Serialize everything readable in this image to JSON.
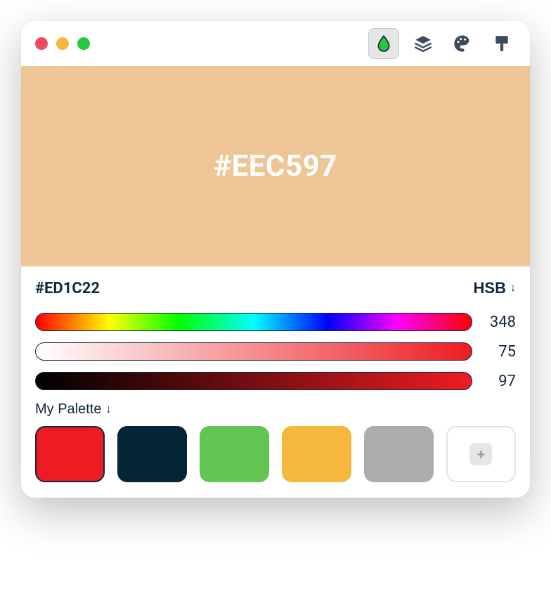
{
  "preview": {
    "background": "#EEC597",
    "hexDisplay": "#EEC597"
  },
  "selectedHex": "#ED1C22",
  "colorMode": "HSB",
  "sliders": {
    "hue": 348,
    "saturation": 75,
    "brightness": 97,
    "saturationGradient": [
      "#FFFFFF",
      "#ED1C22"
    ],
    "brightnessGradient": [
      "#000000",
      "#ED1C22"
    ]
  },
  "palette": {
    "label": "My Palette",
    "swatches": [
      {
        "color": "#ED1C22",
        "selected": true
      },
      {
        "color": "#052437",
        "selected": false
      },
      {
        "color": "#62C451",
        "selected": false
      },
      {
        "color": "#F6B83C",
        "selected": false
      },
      {
        "color": "#ACACAC",
        "selected": false
      }
    ]
  },
  "toolbar": {
    "activeIndex": 0,
    "icons": [
      "droplet-icon",
      "layers-icon",
      "palette-icon",
      "brush-icon"
    ]
  }
}
